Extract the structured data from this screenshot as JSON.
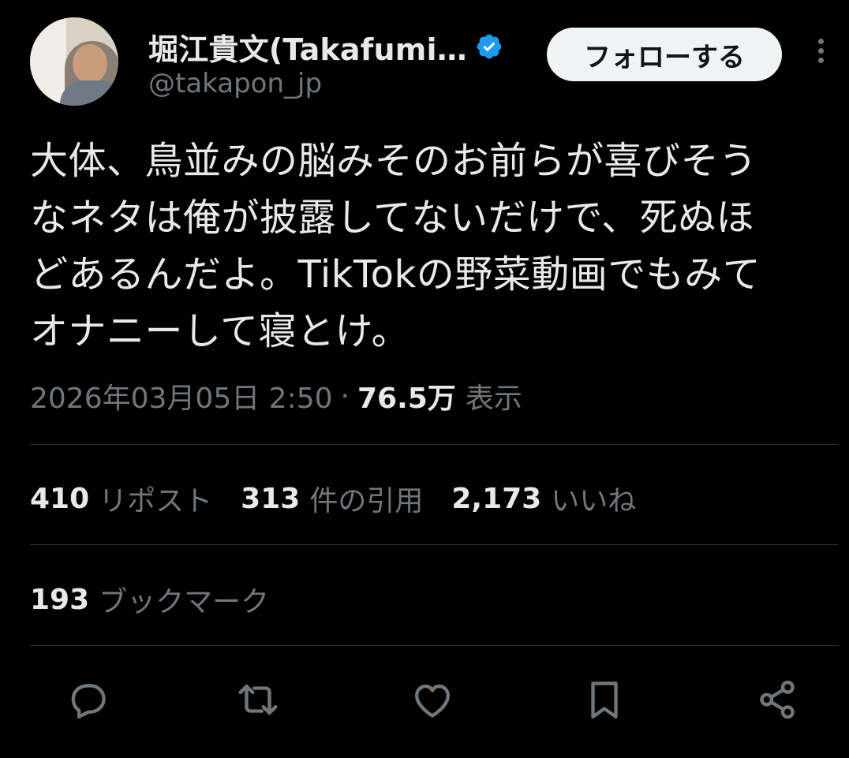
{
  "author": {
    "display_name": "堀江貴文(Takafumi…",
    "handle": "@takapon_jp",
    "verified_icon": "verified-badge-icon",
    "avatar_label": "avatar"
  },
  "follow_label": "フォローする",
  "tweet": {
    "text": "大体、鳥並みの脳みそのお前らが喜びそう\nなネタは俺が披露してないだけで、死ぬほ\nどあるんだよ。TikTokの野菜動画でもみて\nオナニーして寝とけ。"
  },
  "meta": {
    "datetime": "2026年03月05日 2:50",
    "separator": "·",
    "views": "76.5万",
    "views_label": "表示"
  },
  "stats": [
    {
      "count": "410",
      "label": "リポスト"
    },
    {
      "count": "313",
      "label": "件の引用"
    },
    {
      "count": "2,173",
      "label": "いいね"
    }
  ],
  "bookmarks": {
    "count": "193",
    "label": "ブックマーク"
  },
  "actions": [
    "reply-icon",
    "retweet-icon",
    "like-icon",
    "bookmark-icon",
    "share-icon"
  ],
  "colors": {
    "background": "#000000",
    "text": "#e7e9ea",
    "secondary": "#71767b",
    "verified": "#1d9bf0",
    "button": "#eff3f4"
  }
}
